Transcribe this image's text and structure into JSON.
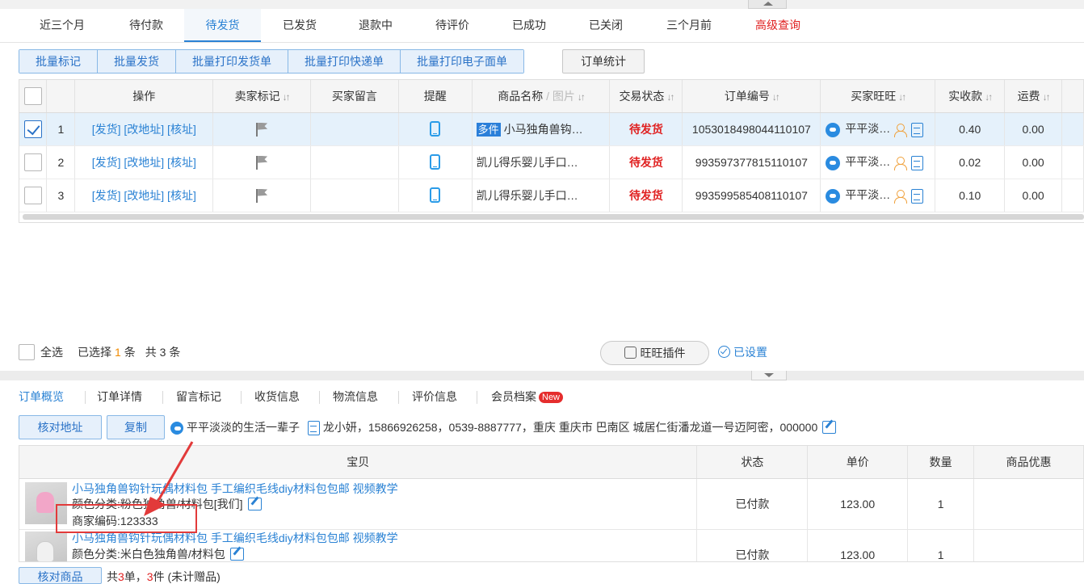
{
  "tabs": [
    "近三个月",
    "待付款",
    "待发货",
    "已发货",
    "退款中",
    "待评价",
    "已成功",
    "已关闭",
    "三个月前",
    "高级查询"
  ],
  "toolbar": {
    "batch_buttons": [
      "批量标记",
      "批量发货",
      "批量打印发货单",
      "批量打印快递单",
      "批量打印电子面单"
    ],
    "stats_button": "订单统计"
  },
  "grid": {
    "headers": {
      "ops": "操作",
      "seller_mark": "卖家标记",
      "buyer_msg": "买家留言",
      "remind": "提醒",
      "product_name": "商品名称",
      "product_img": "/ 图片",
      "trade_status": "交易状态",
      "order_no": "订单编号",
      "buyer_wangwang": "买家旺旺",
      "paid": "实收款",
      "shipping": "运费"
    },
    "sort_icon": "↓↑",
    "ops_text": "[发货] [改地址] [核址]",
    "rows": [
      {
        "idx": "1",
        "tag": "多件",
        "product": "小马独角兽钩…",
        "status": "待发货",
        "order_no": "1053018498044110107",
        "buyer": "平平淡…",
        "paid": "0.40",
        "ship": "0.00",
        "selected": true
      },
      {
        "idx": "2",
        "tag": "",
        "product": "凯儿得乐婴儿手口…",
        "status": "待发货",
        "order_no": "993597377815110107",
        "buyer": "平平淡…",
        "paid": "0.02",
        "ship": "0.00",
        "selected": false
      },
      {
        "idx": "3",
        "tag": "",
        "product": "凯儿得乐婴儿手口…",
        "status": "待发货",
        "order_no": "993599585408110107",
        "buyer": "平平淡…",
        "paid": "0.10",
        "ship": "0.00",
        "selected": false
      }
    ]
  },
  "footer": {
    "select_all": "全选",
    "selected_prefix": "已选择",
    "selected_count": "1",
    "selected_suffix": "条",
    "total": "共 3 条",
    "wangwang_plugin": "旺旺插件",
    "configured": "已设置"
  },
  "detail_tabs": {
    "items": [
      "订单概览",
      "订单详情",
      "留言标记",
      "收货信息",
      "物流信息",
      "评价信息",
      "会员档案"
    ],
    "new_badge": "New"
  },
  "detail": {
    "verify_address": "核对地址",
    "copy": "复制",
    "buyer_nick": "平平淡淡的生活一辈子",
    "address": "龙小妍，15866926258，0539-8887777，重庆 重庆市 巴南区 城居仁街潘龙道一号迈阿密，000000"
  },
  "items_table": {
    "headers": [
      "宝贝",
      "状态",
      "单价",
      "数量",
      "商品优惠"
    ],
    "rows": [
      {
        "title": "小马独角兽钩针玩偶材料包 手工编织毛线diy材料包包邮 视频教学",
        "sku": "颜色分类:粉色独角兽/材料包[我们]",
        "merchant_code": "商家编码:123333",
        "status": "已付款",
        "price": "123.00",
        "qty": "1"
      },
      {
        "title": "小马独角兽钩针玩偶材料包 手工编织毛线diy材料包包邮 视频教学",
        "sku": "颜色分类:米白色独角兽/材料包",
        "merchant_code": "",
        "status": "已付款",
        "price": "123.00",
        "qty": "1"
      }
    ]
  },
  "bottom": {
    "verify_goods": "核对商品",
    "summary_prefix": "共",
    "order_count": "3",
    "summary_mid": "单，",
    "item_count": "3",
    "summary_suffix": "件 (未计赠品)"
  },
  "colors": {
    "accent": "#2a82d4",
    "alert_red": "#e02020",
    "highlight_box": "#e23a3a"
  }
}
